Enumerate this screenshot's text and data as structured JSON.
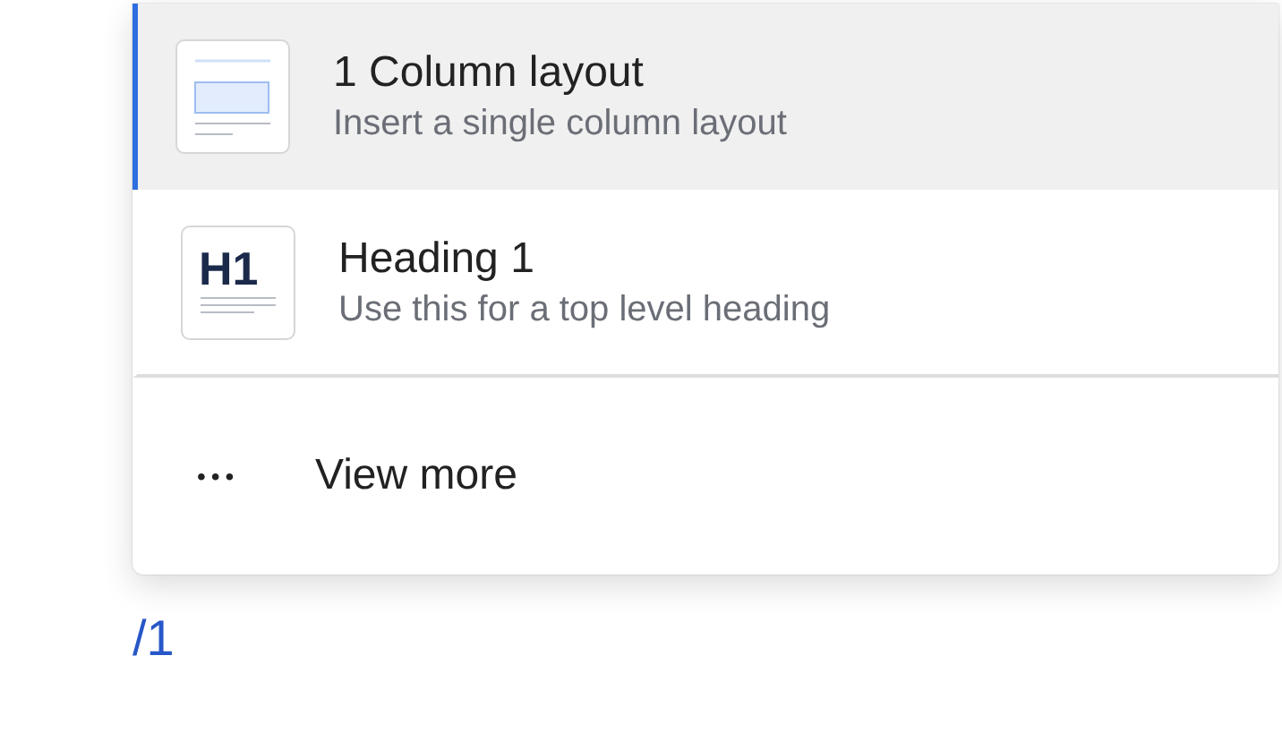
{
  "menu": {
    "items": [
      {
        "kind": "layout",
        "title": "1 Column layout",
        "description": "Insert a single column layout",
        "selected": true
      },
      {
        "kind": "heading",
        "icon_text": "H1",
        "title": "Heading 1",
        "description": "Use this for a top level heading",
        "selected": false
      }
    ],
    "more": {
      "icon": "•••",
      "label": "View more"
    }
  },
  "editor": {
    "text": "/1"
  }
}
